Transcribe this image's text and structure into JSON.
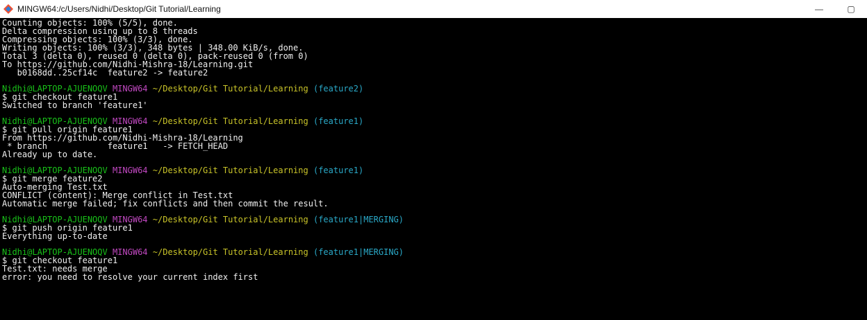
{
  "window": {
    "title": "MINGW64:/c/Users/Nidhi/Desktop/Git Tutorial/Learning",
    "minimize": "—",
    "maximize": "▢"
  },
  "terminal": {
    "colors": {
      "user": "#19c319",
      "shell": "#c148c1",
      "path": "#c9c429",
      "branch": "#2aa9c8"
    },
    "prompt_user": "Nidhi@LAPTOP-AJUENOQV",
    "prompt_shell": "MINGW64",
    "prompt_path": "~/Desktop/Git Tutorial/Learning",
    "blocks": [
      {
        "output": [
          "Counting objects: 100% (5/5), done.",
          "Delta compression using up to 8 threads",
          "Compressing objects: 100% (3/3), done.",
          "Writing objects: 100% (3/3), 348 bytes | 348.00 KiB/s, done.",
          "Total 3 (delta 0), reused 0 (delta 0), pack-reused 0 (from 0)",
          "To https://github.com/Nidhi-Mishra-18/Learning.git",
          "   b0168dd..25cf14c  feature2 -> feature2"
        ]
      },
      {
        "branch": "(feature2)",
        "command": "$ git checkout feature1",
        "output": [
          "Switched to branch 'feature1'"
        ]
      },
      {
        "branch": "(feature1)",
        "command": "$ git pull origin feature1",
        "output": [
          "From https://github.com/Nidhi-Mishra-18/Learning",
          " * branch            feature1   -> FETCH_HEAD",
          "Already up to date."
        ]
      },
      {
        "branch": "(feature1)",
        "command": "$ git merge feature2",
        "output": [
          "Auto-merging Test.txt",
          "CONFLICT (content): Merge conflict in Test.txt",
          "Automatic merge failed; fix conflicts and then commit the result."
        ]
      },
      {
        "branch": "(feature1|MERGING)",
        "command": "$ git push origin feature1",
        "output": [
          "Everything up-to-date"
        ]
      },
      {
        "branch": "(feature1|MERGING)",
        "command": "$ git checkout feature1",
        "output": [
          "Test.txt: needs merge",
          "error: you need to resolve your current index first"
        ]
      }
    ]
  }
}
